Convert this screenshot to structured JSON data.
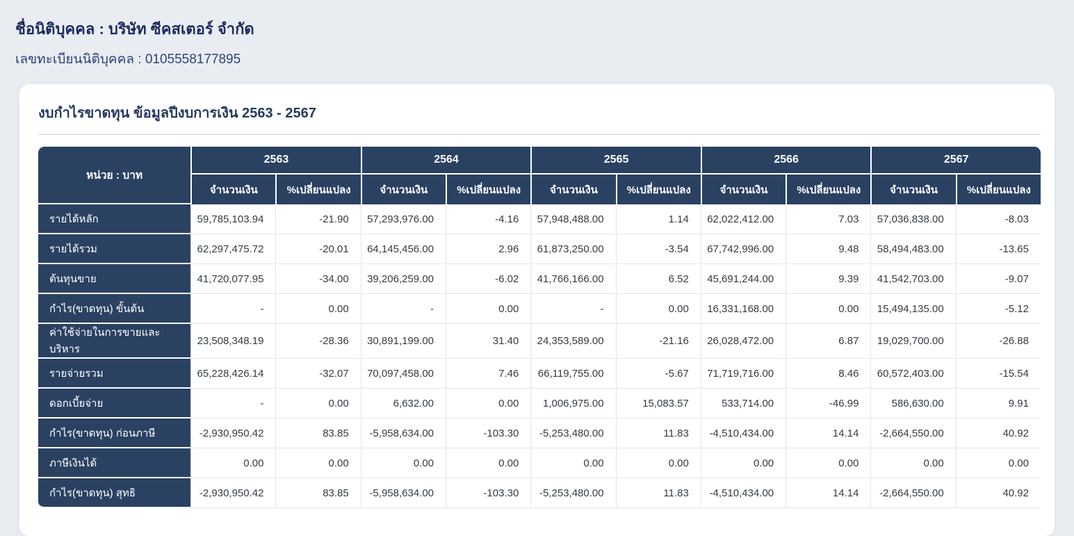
{
  "header": {
    "company_line": "ชื่อนิติบุคคล : บริษัท ซีคสเตอร์ จำกัด",
    "registration_line": "เลขทะเบียนนิติบุคคล : 0105558177895"
  },
  "card": {
    "title": "งบกำไรขาดทุน ข้อมูลปีงบการเงิน 2563 - 2567"
  },
  "table": {
    "unit_header": "หน่วย : บาท",
    "years": [
      "2563",
      "2564",
      "2565",
      "2566",
      "2567"
    ],
    "sub_headers": {
      "amount": "จำนวนเงิน",
      "change": "%เปลี่ยนแปลง"
    },
    "rows": [
      {
        "label": "รายได้หลัก",
        "cells": [
          {
            "amount": "59,785,103.94",
            "change": "-21.90"
          },
          {
            "amount": "57,293,976.00",
            "change": "-4.16"
          },
          {
            "amount": "57,948,488.00",
            "change": "1.14"
          },
          {
            "amount": "62,022,412.00",
            "change": "7.03"
          },
          {
            "amount": "57,036,838.00",
            "change": "-8.03"
          }
        ]
      },
      {
        "label": "รายได้รวม",
        "cells": [
          {
            "amount": "62,297,475.72",
            "change": "-20.01"
          },
          {
            "amount": "64,145,456.00",
            "change": "2.96"
          },
          {
            "amount": "61,873,250.00",
            "change": "-3.54"
          },
          {
            "amount": "67,742,996.00",
            "change": "9.48"
          },
          {
            "amount": "58,494,483.00",
            "change": "-13.65"
          }
        ]
      },
      {
        "label": "ต้นทุนขาย",
        "cells": [
          {
            "amount": "41,720,077.95",
            "change": "-34.00"
          },
          {
            "amount": "39,206,259.00",
            "change": "-6.02"
          },
          {
            "amount": "41,766,166.00",
            "change": "6.52"
          },
          {
            "amount": "45,691,244.00",
            "change": "9.39"
          },
          {
            "amount": "41,542,703.00",
            "change": "-9.07"
          }
        ]
      },
      {
        "label": "กำไร(ขาดทุน) ขั้นต้น",
        "cells": [
          {
            "amount": "-",
            "change": "0.00"
          },
          {
            "amount": "-",
            "change": "0.00"
          },
          {
            "amount": "-",
            "change": "0.00"
          },
          {
            "amount": "16,331,168.00",
            "change": "0.00"
          },
          {
            "amount": "15,494,135.00",
            "change": "-5.12"
          }
        ]
      },
      {
        "label": "ค่าใช้จ่ายในการขายและบริหาร",
        "cells": [
          {
            "amount": "23,508,348.19",
            "change": "-28.36"
          },
          {
            "amount": "30,891,199.00",
            "change": "31.40"
          },
          {
            "amount": "24,353,589.00",
            "change": "-21.16"
          },
          {
            "amount": "26,028,472.00",
            "change": "6.87"
          },
          {
            "amount": "19,029,700.00",
            "change": "-26.88"
          }
        ]
      },
      {
        "label": "รายจ่ายรวม",
        "cells": [
          {
            "amount": "65,228,426.14",
            "change": "-32.07"
          },
          {
            "amount": "70,097,458.00",
            "change": "7.46"
          },
          {
            "amount": "66,119,755.00",
            "change": "-5.67"
          },
          {
            "amount": "71,719,716.00",
            "change": "8.46"
          },
          {
            "amount": "60,572,403.00",
            "change": "-15.54"
          }
        ]
      },
      {
        "label": "ดอกเบี้ยจ่าย",
        "cells": [
          {
            "amount": "-",
            "change": "0.00"
          },
          {
            "amount": "6,632.00",
            "change": "0.00"
          },
          {
            "amount": "1,006,975.00",
            "change": "15,083.57"
          },
          {
            "amount": "533,714.00",
            "change": "-46.99"
          },
          {
            "amount": "586,630.00",
            "change": "9.91"
          }
        ]
      },
      {
        "label": "กำไร(ขาดทุน) ก่อนภาษี",
        "cells": [
          {
            "amount": "-2,930,950.42",
            "change": "83.85"
          },
          {
            "amount": "-5,958,634.00",
            "change": "-103.30"
          },
          {
            "amount": "-5,253,480.00",
            "change": "11.83"
          },
          {
            "amount": "-4,510,434.00",
            "change": "14.14"
          },
          {
            "amount": "-2,664,550.00",
            "change": "40.92"
          }
        ]
      },
      {
        "label": "ภาษีเงินได้",
        "cells": [
          {
            "amount": "0.00",
            "change": "0.00"
          },
          {
            "amount": "0.00",
            "change": "0.00"
          },
          {
            "amount": "0.00",
            "change": "0.00"
          },
          {
            "amount": "0.00",
            "change": "0.00"
          },
          {
            "amount": "0.00",
            "change": "0.00"
          }
        ]
      },
      {
        "label": "กำไร(ขาดทุน) สุทธิ",
        "cells": [
          {
            "amount": "-2,930,950.42",
            "change": "83.85"
          },
          {
            "amount": "-5,958,634.00",
            "change": "-103.30"
          },
          {
            "amount": "-5,253,480.00",
            "change": "11.83"
          },
          {
            "amount": "-4,510,434.00",
            "change": "14.14"
          },
          {
            "amount": "-2,664,550.00",
            "change": "40.92"
          }
        ]
      }
    ]
  },
  "colors": {
    "page_bg": "#e9edf2",
    "card_bg": "#ffffff",
    "navy": "#2a4162",
    "title_navy": "#27395e",
    "h1_navy": "#1e2b5e",
    "sub_navy": "#2c4276",
    "cell_border": "#e2e6ea",
    "data_text": "#343b41"
  }
}
